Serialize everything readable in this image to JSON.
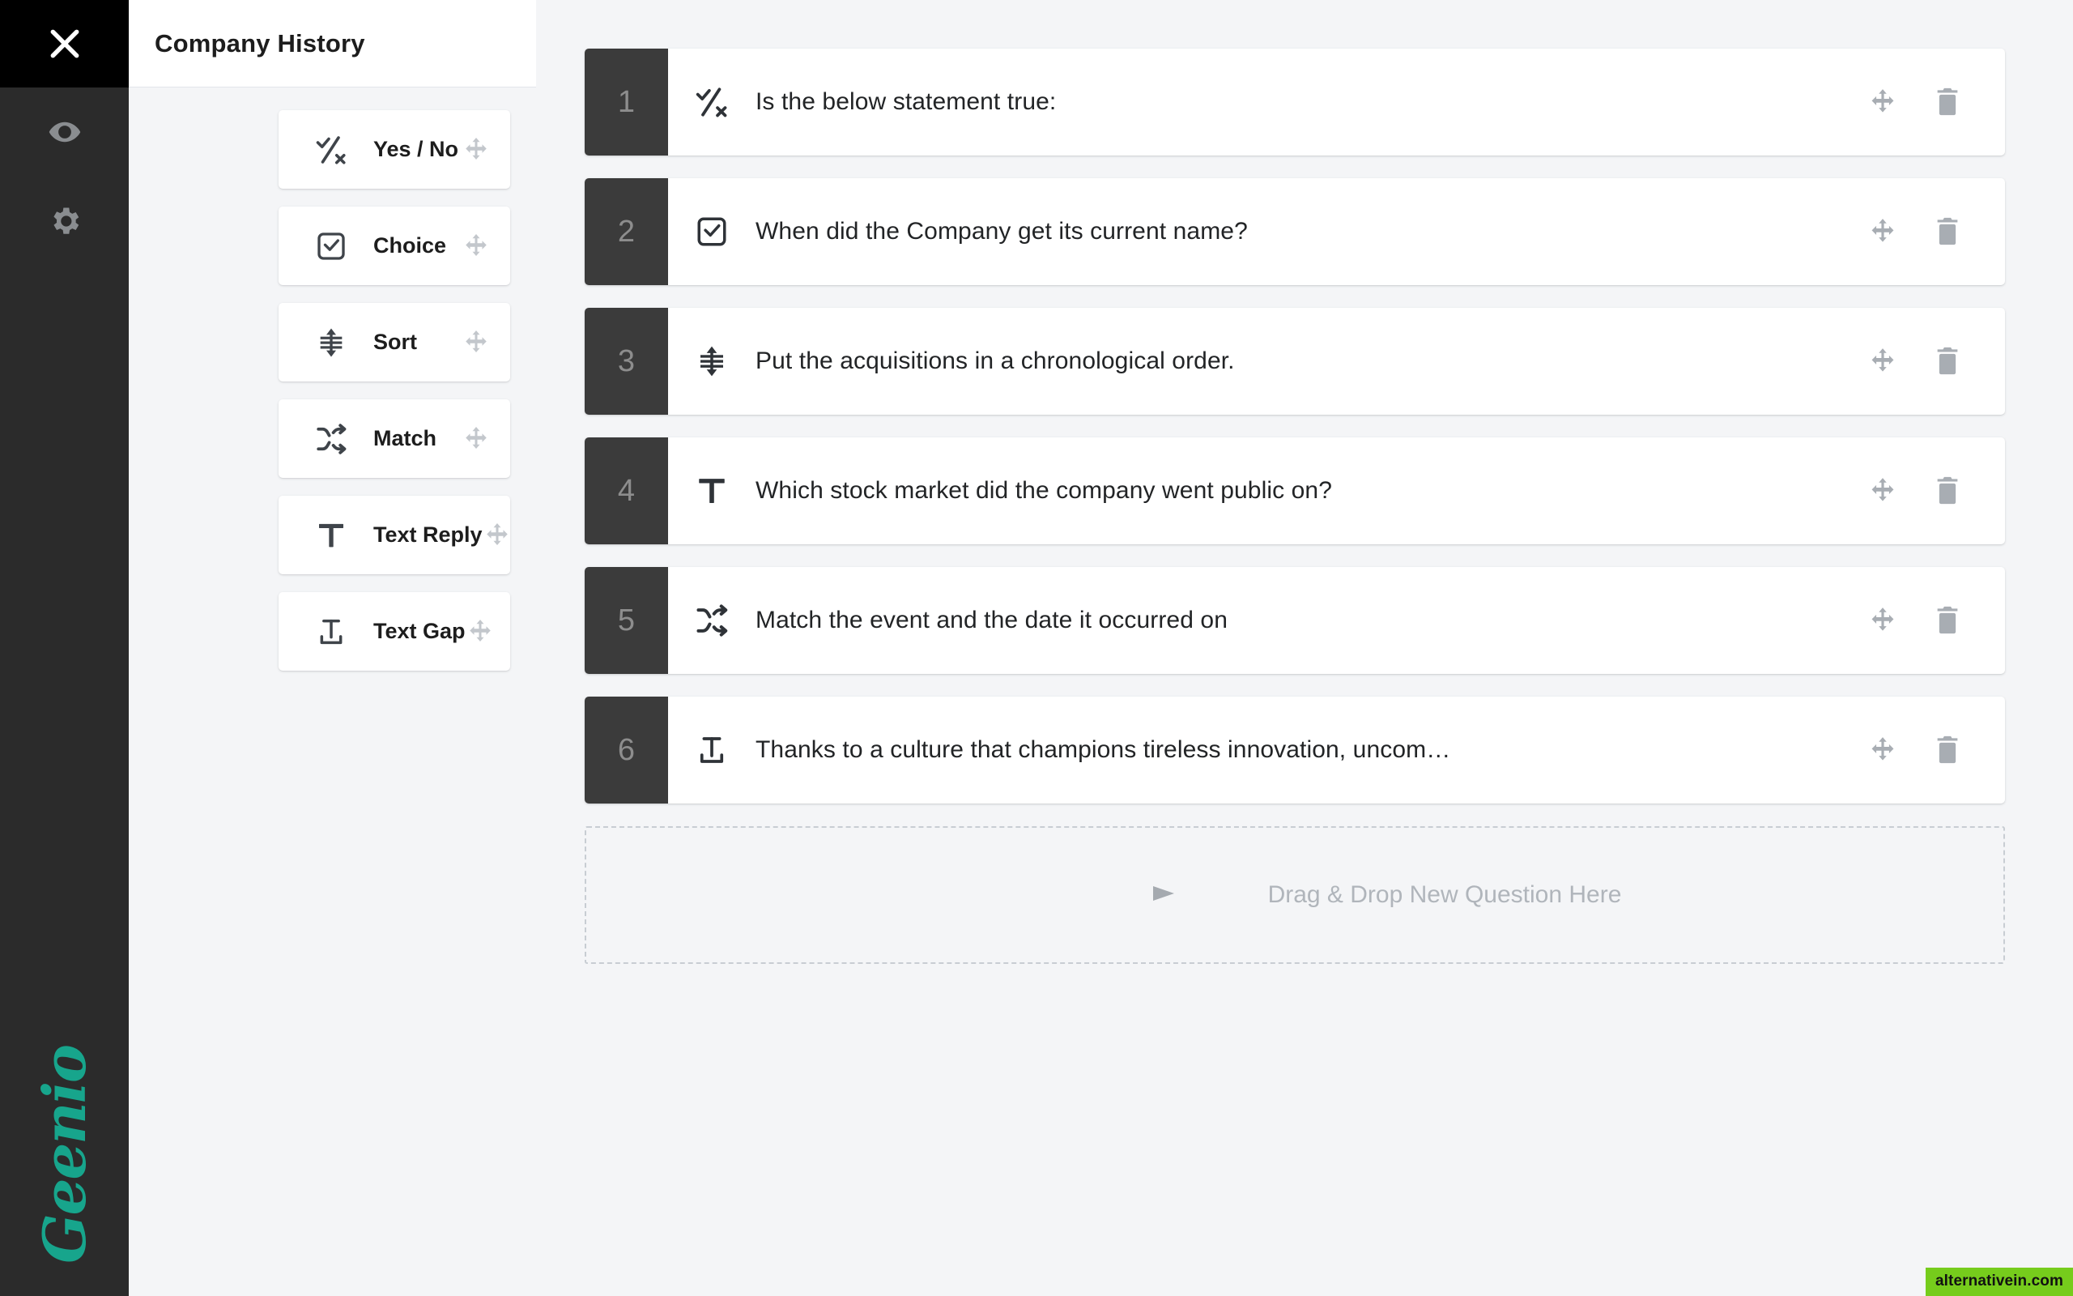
{
  "rail": {
    "close_label": "Close",
    "close_icon": "close-icon",
    "buttons": [
      {
        "name": "preview",
        "icon": "eye-icon",
        "label": "Preview"
      },
      {
        "name": "settings",
        "icon": "gear-icon",
        "label": "Settings"
      }
    ],
    "logo_text": "Geenio",
    "logo_color": "#17a58c"
  },
  "palette": {
    "title": "Company History",
    "items": [
      {
        "label": "Yes / No",
        "icon": "yes-no-icon",
        "handle": "move-icon"
      },
      {
        "label": "Choice",
        "icon": "checkbox-icon",
        "handle": "move-icon"
      },
      {
        "label": "Sort",
        "icon": "sort-icon",
        "handle": "move-icon"
      },
      {
        "label": "Match",
        "icon": "shuffle-icon",
        "handle": "move-icon"
      },
      {
        "label": "Text Reply",
        "icon": "text-icon",
        "handle": "move-icon"
      },
      {
        "label": "Text Gap",
        "icon": "text-gap-icon",
        "handle": "move-icon"
      }
    ]
  },
  "questions": [
    {
      "index": "1",
      "icon": "yes-no-icon",
      "text": "Is the below statement true:",
      "move": "move-icon",
      "delete": "trash-icon"
    },
    {
      "index": "2",
      "icon": "checkbox-icon",
      "text": "When did the Company get its current name?",
      "move": "move-icon",
      "delete": "trash-icon"
    },
    {
      "index": "3",
      "icon": "sort-icon",
      "text": "Put the acquisitions in a chronological order.",
      "move": "move-icon",
      "delete": "trash-icon"
    },
    {
      "index": "4",
      "icon": "text-icon",
      "text": "Which stock market did the company went public on?",
      "move": "move-icon",
      "delete": "trash-icon"
    },
    {
      "index": "5",
      "icon": "shuffle-icon",
      "text": "Match the event and the date it occurred on",
      "move": "move-icon",
      "delete": "trash-icon"
    },
    {
      "index": "6",
      "icon": "text-gap-icon",
      "text": "Thanks to a culture that champions tireless innovation, uncom…",
      "move": "move-icon",
      "delete": "trash-icon"
    }
  ],
  "dropzone": {
    "text": "Drag & Drop New Question Here",
    "arrow_icon": "arrow-right-icon"
  },
  "watermark": {
    "text": "alternativein.com",
    "bg": "#76cc1c"
  },
  "colors": {
    "rail_bg": "#2b2b2b",
    "rail_close_bg": "#000000",
    "canvas_bg": "#f4f5f7",
    "card_bg": "#ffffff",
    "index_bg": "#3b3b3b",
    "index_text": "#8d8d8d",
    "accent": "#17a58c"
  }
}
